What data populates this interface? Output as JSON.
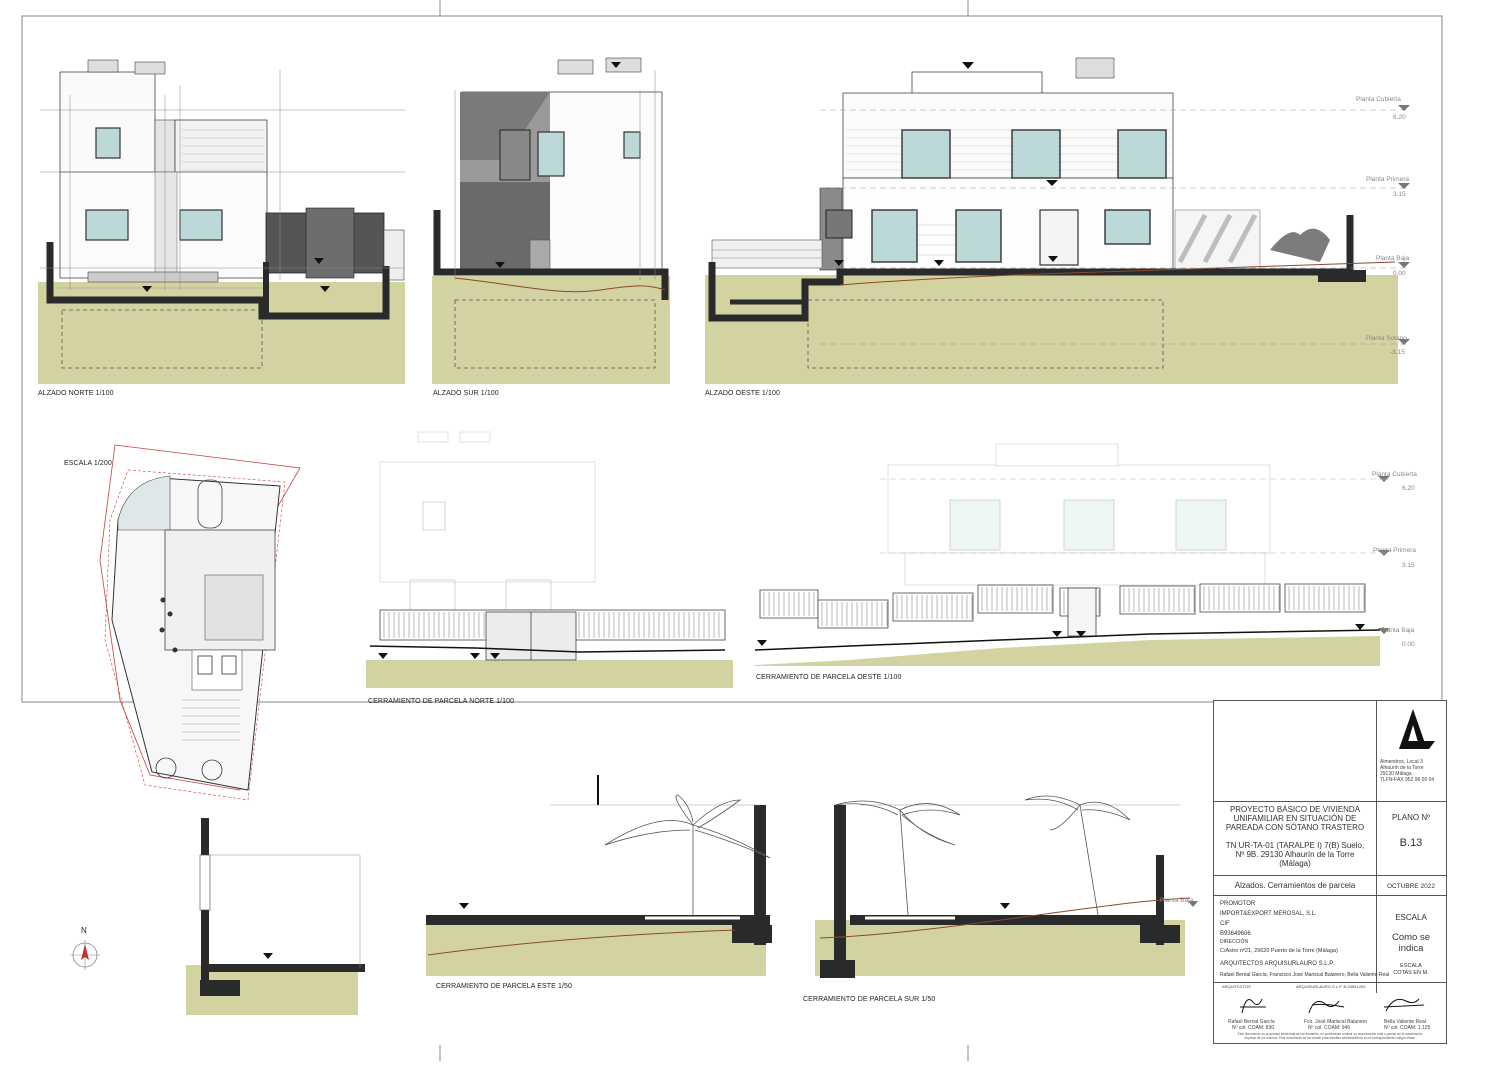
{
  "drawings": {
    "alzado_norte": "ALZADO NORTE   1/100",
    "alzado_sur": "ALZADO SUR   1/100",
    "alzado_oeste": "ALZADO OESTE   1/100",
    "escala_plano": "ESCALA 1/200",
    "cerramiento_norte": "CERRAMIENTO DE PARCELA NORTE   1/100",
    "cerramiento_oeste": "CERRAMIENTO DE PARCELA OESTE   1/100",
    "cerramiento_este": "CERRAMIENTO DE PARCELA ESTE   1/50",
    "cerramiento_sur": "CERRAMIENTO DE PARCELA SUR   1/50"
  },
  "levels": {
    "cubierta": "Planta Cubierta",
    "cubierta_val": "6.20",
    "primera": "Planta Primera",
    "primera_val": "3.15",
    "baja": "Planta Baja",
    "baja_val": "0.00",
    "sotano": "Planta Sótano",
    "sotano_val": "-3.15",
    "oeste_baja_val": "0.00"
  },
  "north_arrow": "N",
  "colors": {
    "ground": "#d3d3a1",
    "wall": "#2a2a2a",
    "redline": "#c84040"
  },
  "title_block": {
    "address_lines": [
      "Almendros, Local 3",
      "Alhaurín de la Torre",
      "29130 Málaga",
      "TLFN-FAX 952 96 00 04"
    ],
    "project_title": [
      "PROYECTO BÁSICO DE VIVIENDA",
      "UNIFAMILIAR EN SITUACIÓN DE",
      "PAREADA CON SÓTANO TRASTERO"
    ],
    "location": [
      "TN UR-TA-01 (TARALPE I) 7(B) Suelo,",
      "Nº 9B. 29130 Alhaurín de la Torre",
      "(Málaga)"
    ],
    "plano_label": "PLANO Nº",
    "plano_number": "B.13",
    "sheet_title": "Alzados. Cerramientos de parcela",
    "date": "OCTUBRE 2022",
    "escala_label": "ESCALA",
    "escala_value": [
      "Como se",
      "indica"
    ],
    "escala_sub": [
      "ESCALA",
      "COTAS EN M."
    ],
    "promotor_label": "PROMOTOR",
    "promotor_name": "IMPORT&EXPORT MEROSAL, S.L.",
    "cif_label": "CIF",
    "cif_value": "B93649606",
    "direccion_label": "DIRECCIÓN",
    "direccion_value": "C/Astro nº21, 29620  Puerto de la Torre (Málaga)",
    "arquitectos_firm": "ARQUITECTOS ARQUISURLAURO S.L.P.",
    "arquitectos_names": "Rafael Bernal García,  Francisco José Mariscal Balanero, Bella Valiente Real",
    "sig_header_left": "ARQUITECTOS",
    "sig_header_mid": "ARQUISURLAURO S.L.P. B-93651263",
    "signers": [
      {
        "name": "Rafael Bernal García",
        "num": "Nº col. COAM: 830"
      },
      {
        "name": "Fco. José Mariscal Balanero",
        "num": "Nº col. COAM: 946"
      },
      {
        "name": "Bella Valiente Real",
        "num": "Nº col. COAM: 1.125"
      }
    ],
    "footnote": [
      "Este documento es propiedad intelectual de los firmantes, no pudiéndose realizar su reproducción total o parcial sin la autorización",
      "expresa de los mismos. Este documento se ha creado para trámites administrativos en el correspondiente colegio oficial."
    ]
  }
}
